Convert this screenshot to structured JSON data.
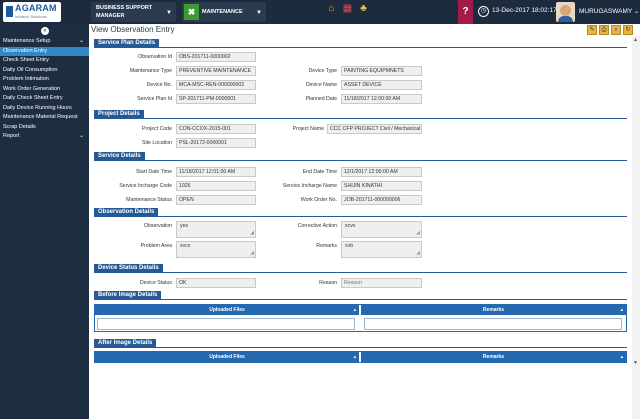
{
  "topbar": {
    "logo_text": "AGARAM",
    "logo_tagline": "Infotech Solutions",
    "module1_label": "BUSINESS SUPPORT MANAGER",
    "module2_label": "MAINTENANCE",
    "help_label": "?",
    "datetime": "13-Dec-2017 18:02:17",
    "username": "MURUGASWAMY"
  },
  "sidebar": {
    "items": [
      {
        "label": "Maintenance Setup",
        "chevron": "⌄"
      },
      {
        "label": "Observation Entry",
        "chevron": ""
      },
      {
        "label": "Check Sheet Entry",
        "chevron": ""
      },
      {
        "label": "Daily Oil Consumption",
        "chevron": ""
      },
      {
        "label": "Problem Intimation",
        "chevron": ""
      },
      {
        "label": "Work Order Generation",
        "chevron": ""
      },
      {
        "label": "Daily Check Sheet Entry",
        "chevron": ""
      },
      {
        "label": "Daily Device Running Hours",
        "chevron": ""
      },
      {
        "label": "Maintenance Material Request",
        "chevron": ""
      },
      {
        "label": "Scrap Details",
        "chevron": ""
      },
      {
        "label": "Report",
        "chevron": "⌄"
      }
    ]
  },
  "page": {
    "title": "View Observation Entry"
  },
  "service_plan": {
    "heading": "Service Plan Details",
    "observation_id_label": "Observation Id",
    "observation_id": "OBS-201711-0000002",
    "maintenance_type_label": "Maintenance Type",
    "maintenance_type": "PREVENTIVE MAINTENANCE",
    "device_type_label": "Device Type",
    "device_type": "PAINTING EQUIPMNETS",
    "device_no_label": "Device No.",
    "device_no": "MCA-MSC-REN-000000002",
    "device_name_label": "Device Name",
    "device_name": "ASSET DEVICE",
    "service_plan_id_label": "Service Plan Id",
    "service_plan_id": "SP-201711-PM-0000001",
    "planned_date_label": "Planned Date",
    "planned_date": "11/18/2017 12:00:00 AM"
  },
  "project": {
    "heading": "Project Details",
    "project_code_label": "Project Code",
    "project_code": "CON-CCOX-2015-001",
    "project_name_label": "Project Name",
    "project_name": "CCC CFP PROJECT Civil / Mechanical",
    "site_location_label": "Site Location",
    "site_location": "PSL-20172-0000001"
  },
  "service": {
    "heading": "Service Details",
    "start_date_label": "Start Date Time",
    "start_date": "11/18/2017 12:01:00 AM",
    "end_date_label": "End Date Time",
    "end_date": "12/1/2017 12:00:00 AM",
    "incharge_code_label": "Service Incharge Code",
    "incharge_code": "1026",
    "incharge_name_label": "Service Incharge Name",
    "incharge_name": "SHIJIN   KINATHI",
    "maintenance_status_label": "Maintenance Status",
    "maintenance_status": "OPEN",
    "work_order_label": "Work Order No.",
    "work_order": "JOB-201711-000000006"
  },
  "observation": {
    "heading": "Observation Details",
    "observation_label": "Observation",
    "observation": "yes",
    "corrective_action_label": "Corrective Action",
    "corrective_action": "xcvx",
    "problem_area_label": "Problem Area",
    "problem_area": "xvcx",
    "remarks_label": "Remarks",
    "remarks": "xvb"
  },
  "device_status": {
    "heading": "Device Status Details",
    "status_label": "Device Status",
    "status": "OK",
    "reason_label": "Reason",
    "reason_placeholder": "Reason"
  },
  "before_images": {
    "heading": "Before Image Details",
    "col_files": "Uploaded Files",
    "col_remarks": "Remarks"
  },
  "after_images": {
    "heading": "After Image Details",
    "col_files": "Uploaded Files",
    "col_remarks": "Remarks"
  },
  "colors": {
    "topbar_bg": "#1c2b3e",
    "sidebar_bg": "#1e2e42",
    "active_item": "#2f87c6",
    "section_header": "#255a97",
    "help_button": "#a21c4a",
    "module_icon": "#3f9a35"
  }
}
